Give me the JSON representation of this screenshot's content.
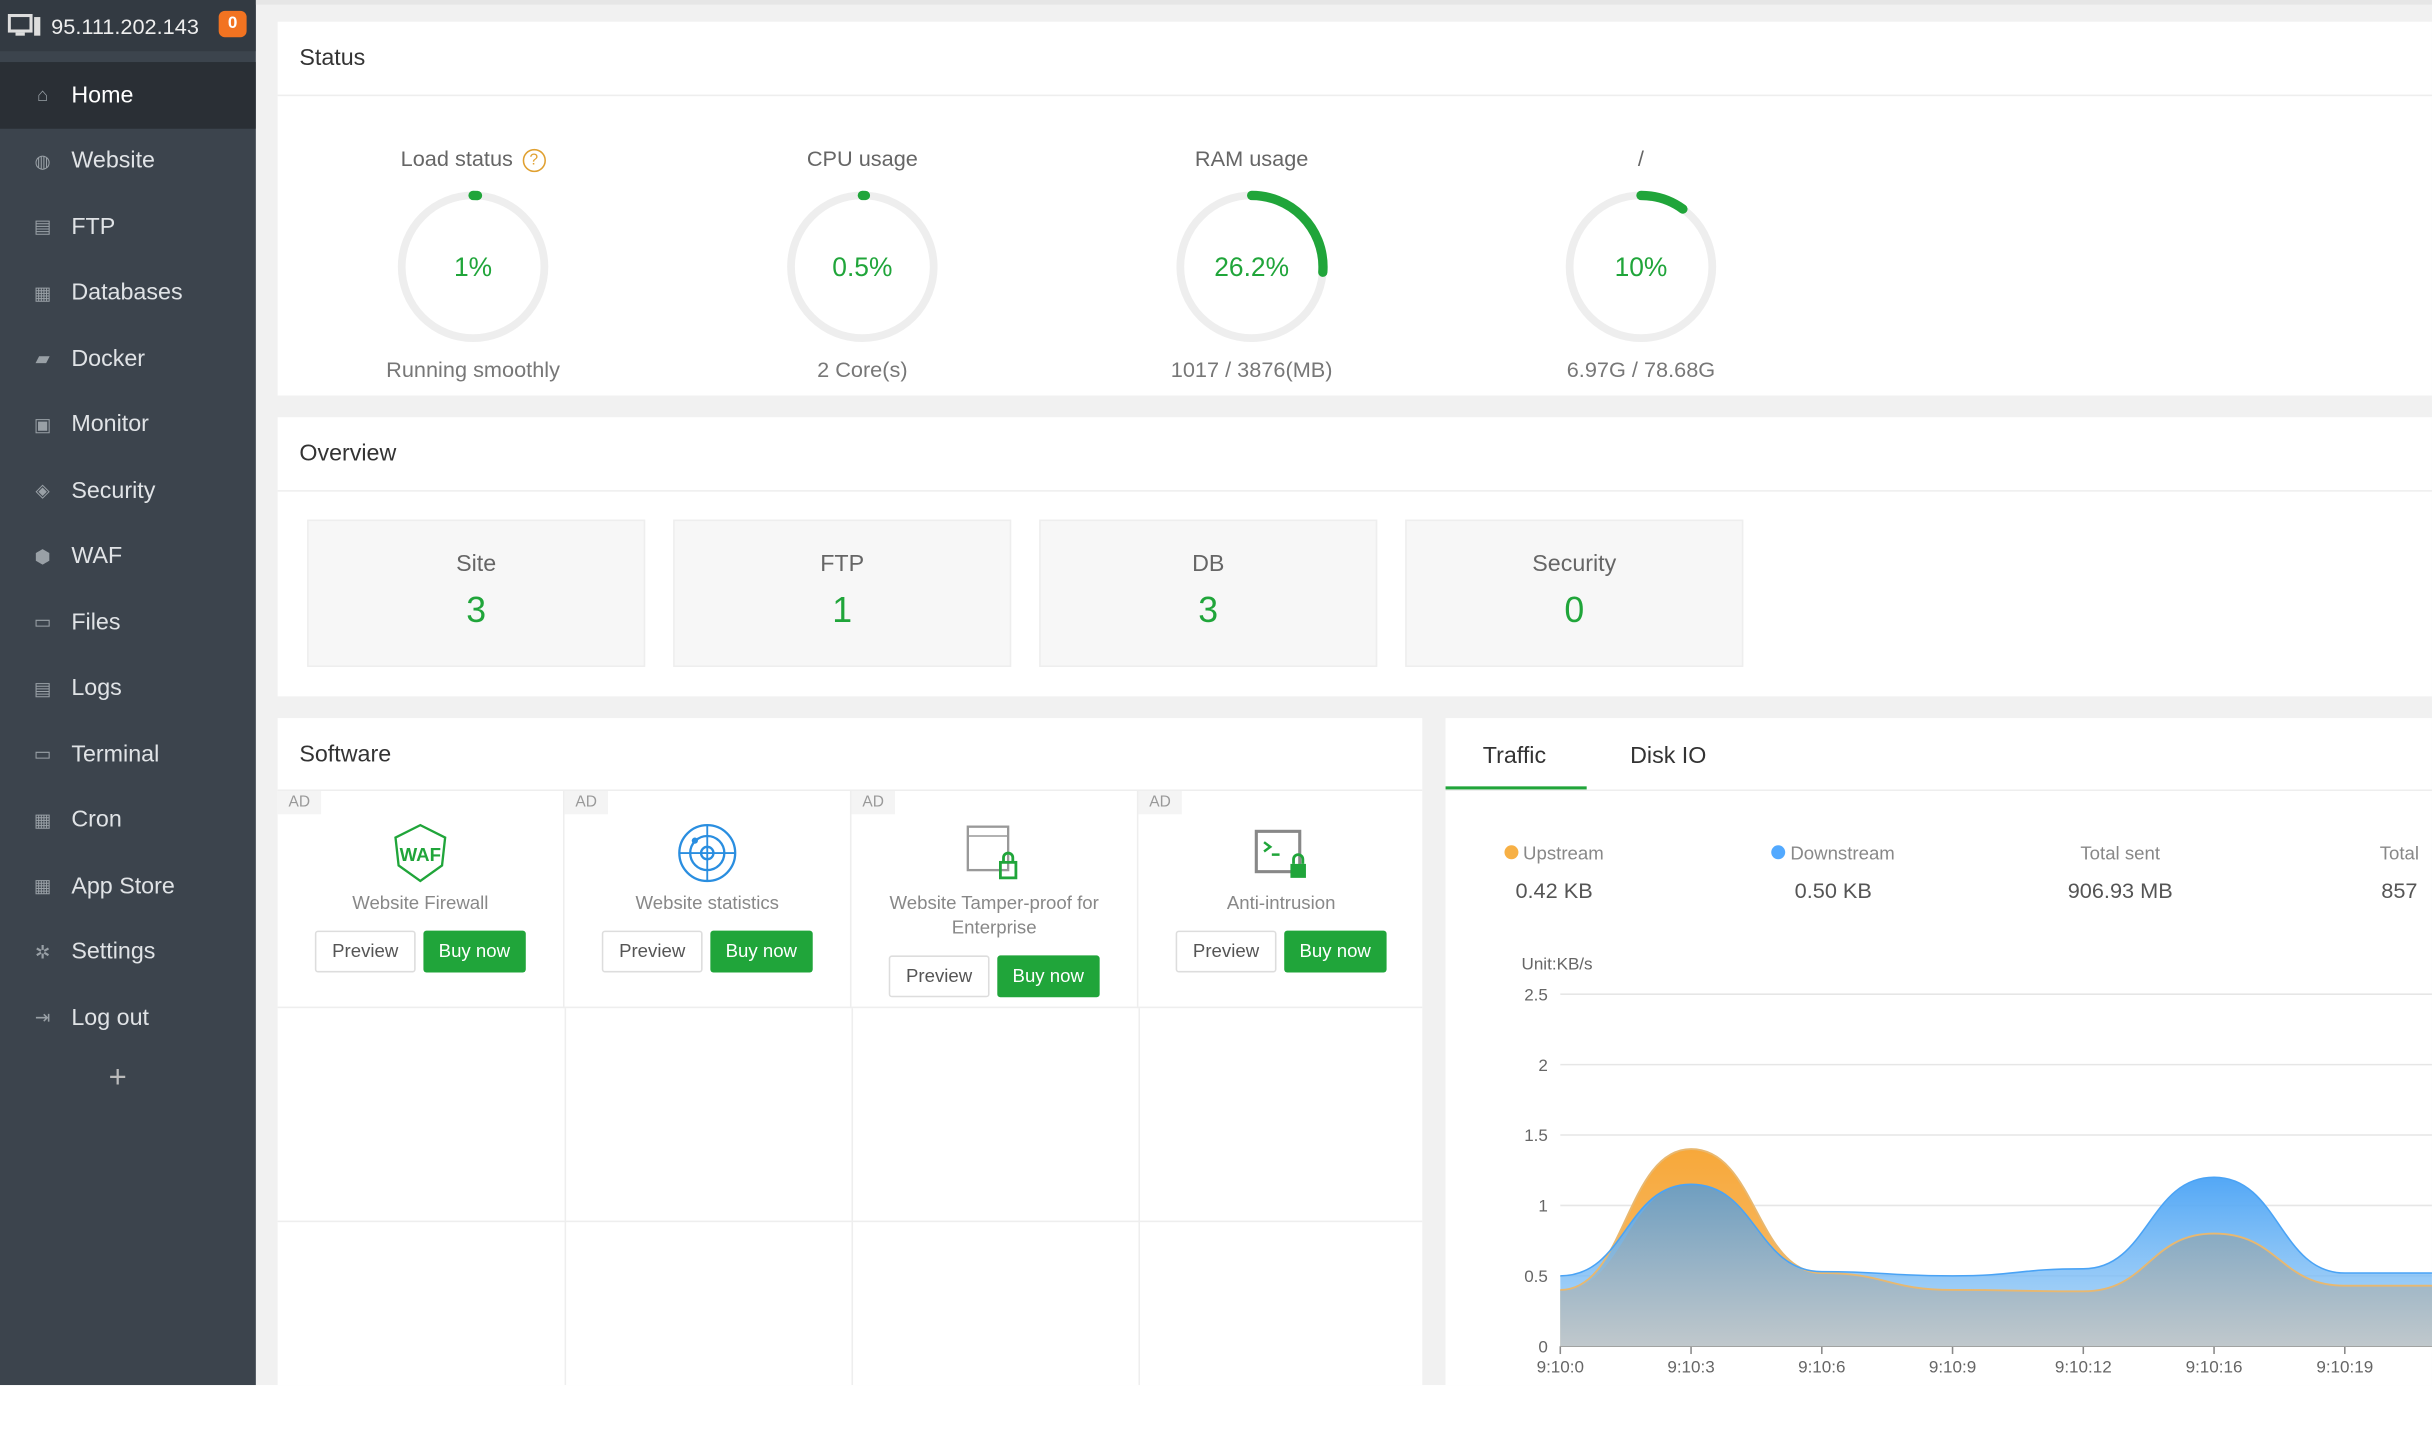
{
  "header": {
    "ip": "95.111.202.143",
    "notifications": "0",
    "icon": "monitor-icon"
  },
  "sidebar": {
    "items": [
      {
        "label": "Home",
        "icon": "home-icon",
        "active": true
      },
      {
        "label": "Website",
        "icon": "globe-icon"
      },
      {
        "label": "FTP",
        "icon": "ftp-icon"
      },
      {
        "label": "Databases",
        "icon": "database-icon"
      },
      {
        "label": "Docker",
        "icon": "docker-icon"
      },
      {
        "label": "Monitor",
        "icon": "monitor-icon"
      },
      {
        "label": "Security",
        "icon": "shield-icon"
      },
      {
        "label": "WAF",
        "icon": "waf-shield-icon"
      },
      {
        "label": "Files",
        "icon": "folder-icon"
      },
      {
        "label": "Logs",
        "icon": "log-icon"
      },
      {
        "label": "Terminal",
        "icon": "terminal-icon"
      },
      {
        "label": "Cron",
        "icon": "calendar-icon"
      },
      {
        "label": "App Store",
        "icon": "grid-icon"
      },
      {
        "label": "Settings",
        "icon": "gear-icon"
      },
      {
        "label": "Log out",
        "icon": "logout-icon"
      }
    ],
    "add": "+"
  },
  "status": {
    "title": "Status",
    "gauges": [
      {
        "label": "Load status",
        "value": "1%",
        "percent": 1,
        "sub": "Running smoothly",
        "help": "?"
      },
      {
        "label": "CPU usage",
        "value": "0.5%",
        "percent": 0.5,
        "sub": "2 Core(s)"
      },
      {
        "label": "RAM usage",
        "value": "26.2%",
        "percent": 26.2,
        "sub": "1017 / 3876(MB)"
      },
      {
        "label": "/",
        "value": "10%",
        "percent": 10,
        "sub": "6.97G / 78.68G"
      }
    ],
    "colors": {
      "ok": "#20a53a",
      "track": "#eeeeee"
    }
  },
  "overview": {
    "title": "Overview",
    "items": [
      {
        "label": "Site",
        "value": "3"
      },
      {
        "label": "FTP",
        "value": "1"
      },
      {
        "label": "DB",
        "value": "3"
      },
      {
        "label": "Security",
        "value": "0"
      }
    ]
  },
  "software": {
    "title": "Software",
    "ad": "AD",
    "preview": "Preview",
    "buy": "Buy now",
    "items": [
      {
        "name": "Website Firewall",
        "icon": "waf-icon"
      },
      {
        "name": "Website statistics",
        "icon": "radar-icon"
      },
      {
        "name": "Website Tamper-proof for Enterprise",
        "icon": "browser-lock-icon"
      },
      {
        "name": "Anti-intrusion",
        "icon": "terminal-lock-icon"
      }
    ]
  },
  "traffic": {
    "tabs": [
      "Traffic",
      "Disk IO"
    ],
    "stats": [
      {
        "label": "Upstream",
        "value": "0.42 KB",
        "color": "#f7b045"
      },
      {
        "label": "Downstream",
        "value": "0.50 KB",
        "color": "#52a9ff"
      },
      {
        "label": "Total sent",
        "value": "906.93 MB"
      },
      {
        "label": "Total",
        "value": "857"
      }
    ]
  },
  "chart_data": {
    "type": "area",
    "unit": "Unit:KB/s",
    "categories": [
      "9:10:0",
      "9:10:3",
      "9:10:6",
      "9:10:9",
      "9:10:12",
      "9:10:16",
      "9:10:19"
    ],
    "yticks": [
      "0",
      "0.5",
      "1",
      "1.5",
      "2",
      "2.5"
    ],
    "ylim": [
      0,
      2.5
    ],
    "grid": true,
    "series": [
      {
        "name": "Upstream",
        "color": "#f7b045",
        "values": [
          0.4,
          1.4,
          0.52,
          0.4,
          0.39,
          0.8,
          0.43
        ]
      },
      {
        "name": "Downstream",
        "color": "#52a9ff",
        "values": [
          0.5,
          1.15,
          0.53,
          0.5,
          0.55,
          1.2,
          0.52
        ]
      }
    ]
  }
}
